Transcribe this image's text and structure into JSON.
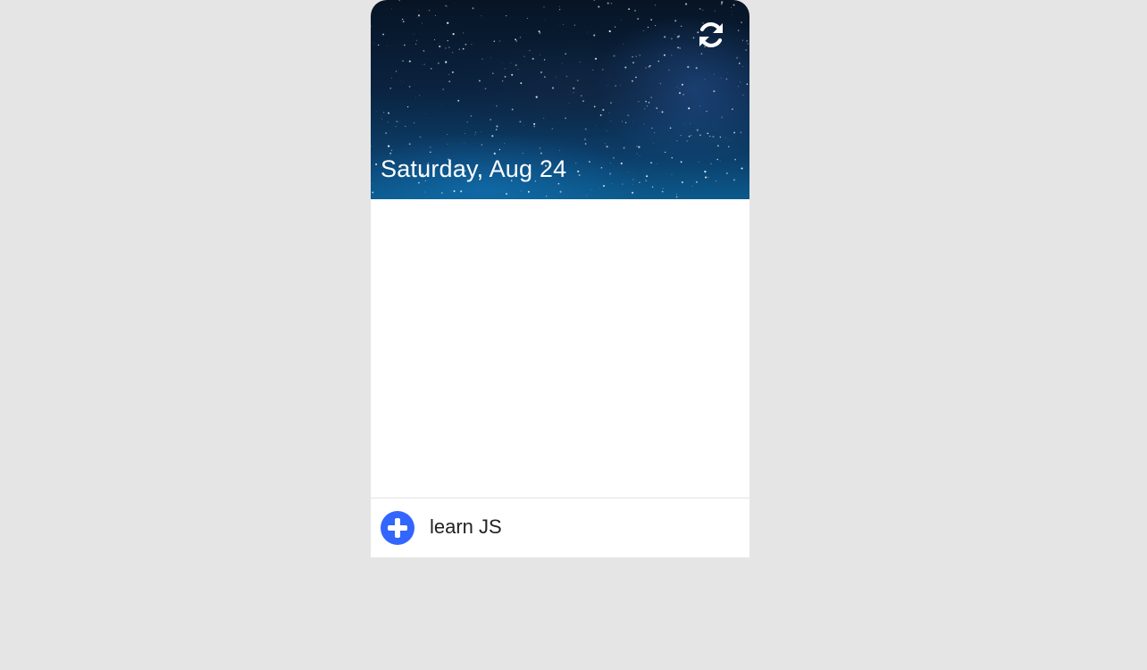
{
  "header": {
    "date": "Saturday, Aug 24",
    "refresh_icon": "refresh-icon"
  },
  "composer": {
    "add_icon": "plus-circle-icon",
    "input_value": "learn JS",
    "accent_color": "#3366ff"
  },
  "colors": {
    "page_background": "#e6e5e5",
    "card_background": "#ffffff"
  }
}
